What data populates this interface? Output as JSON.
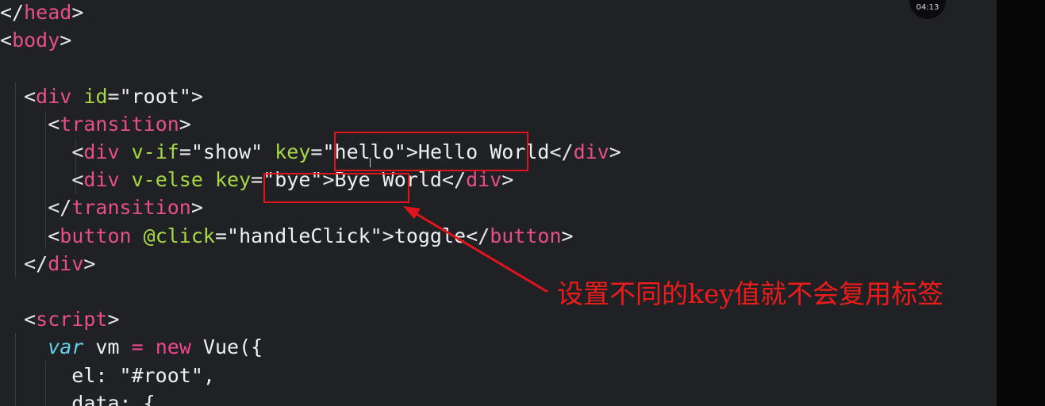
{
  "timer": {
    "time": "04:13"
  },
  "code": {
    "lines": [
      [
        [
          "punct",
          "</"
        ],
        [
          "tag",
          "head"
        ],
        [
          "punct",
          ">"
        ]
      ],
      [
        [
          "punct",
          "<"
        ],
        [
          "tag",
          "body"
        ],
        [
          "punct",
          ">"
        ]
      ],
      [],
      [
        [
          "plain",
          "  "
        ],
        [
          "punct",
          "<"
        ],
        [
          "tag",
          "div"
        ],
        [
          "plain",
          " "
        ],
        [
          "attr",
          "id"
        ],
        [
          "punct",
          "="
        ],
        [
          "str",
          "\"root\""
        ],
        [
          "punct",
          ">"
        ]
      ],
      [
        [
          "plain",
          "    "
        ],
        [
          "punct",
          "<"
        ],
        [
          "tag",
          "transition"
        ],
        [
          "punct",
          ">"
        ]
      ],
      [
        [
          "plain",
          "      "
        ],
        [
          "punct",
          "<"
        ],
        [
          "tag",
          "div"
        ],
        [
          "plain",
          " "
        ],
        [
          "attr",
          "v-if"
        ],
        [
          "punct",
          "="
        ],
        [
          "str",
          "\"show\""
        ],
        [
          "plain",
          " "
        ],
        [
          "attr",
          "key"
        ],
        [
          "punct",
          "="
        ],
        [
          "str",
          "\"hello\""
        ],
        [
          "punct",
          ">"
        ],
        [
          "text",
          "Hello World"
        ],
        [
          "punct",
          "</"
        ],
        [
          "tag",
          "div"
        ],
        [
          "punct",
          ">"
        ]
      ],
      [
        [
          "plain",
          "      "
        ],
        [
          "punct",
          "<"
        ],
        [
          "tag",
          "div"
        ],
        [
          "plain",
          " "
        ],
        [
          "attr",
          "v-else"
        ],
        [
          "plain",
          " "
        ],
        [
          "attr",
          "key"
        ],
        [
          "punct",
          "="
        ],
        [
          "str",
          "\"bye\""
        ],
        [
          "punct",
          ">"
        ],
        [
          "text",
          "Bye World"
        ],
        [
          "punct",
          "</"
        ],
        [
          "tag",
          "div"
        ],
        [
          "punct",
          ">"
        ]
      ],
      [
        [
          "plain",
          "    "
        ],
        [
          "punct",
          "</"
        ],
        [
          "tag",
          "transition"
        ],
        [
          "punct",
          ">"
        ]
      ],
      [
        [
          "plain",
          "    "
        ],
        [
          "punct",
          "<"
        ],
        [
          "tag",
          "button"
        ],
        [
          "plain",
          " "
        ],
        [
          "attr",
          "@click"
        ],
        [
          "punct",
          "="
        ],
        [
          "str",
          "\"handleClick\""
        ],
        [
          "punct",
          ">"
        ],
        [
          "text",
          "toggle"
        ],
        [
          "punct",
          "</"
        ],
        [
          "tag",
          "button"
        ],
        [
          "punct",
          ">"
        ]
      ],
      [
        [
          "plain",
          "  "
        ],
        [
          "punct",
          "</"
        ],
        [
          "tag",
          "div"
        ],
        [
          "punct",
          ">"
        ]
      ],
      [],
      [
        [
          "plain",
          "  "
        ],
        [
          "punct",
          "<"
        ],
        [
          "tag",
          "script"
        ],
        [
          "punct",
          ">"
        ]
      ],
      [
        [
          "plain",
          "    "
        ],
        [
          "kw",
          "var"
        ],
        [
          "plain",
          " vm "
        ],
        [
          "op",
          "="
        ],
        [
          "plain",
          " "
        ],
        [
          "op",
          "new"
        ],
        [
          "plain",
          " Vue({"
        ]
      ],
      [
        [
          "plain",
          "      el: "
        ],
        [
          "str",
          "\"#root\""
        ],
        [
          "plain",
          ","
        ]
      ],
      [
        [
          "plain",
          "      data: {"
        ]
      ]
    ]
  },
  "annotation": {
    "text": "设置不同的key值就不会复用标签",
    "color": "#ee1b1b"
  },
  "colors": {
    "background": "#1f2125",
    "tag": "#e84f86",
    "attribute": "#a6d943",
    "keyword": "#66d0ea"
  }
}
